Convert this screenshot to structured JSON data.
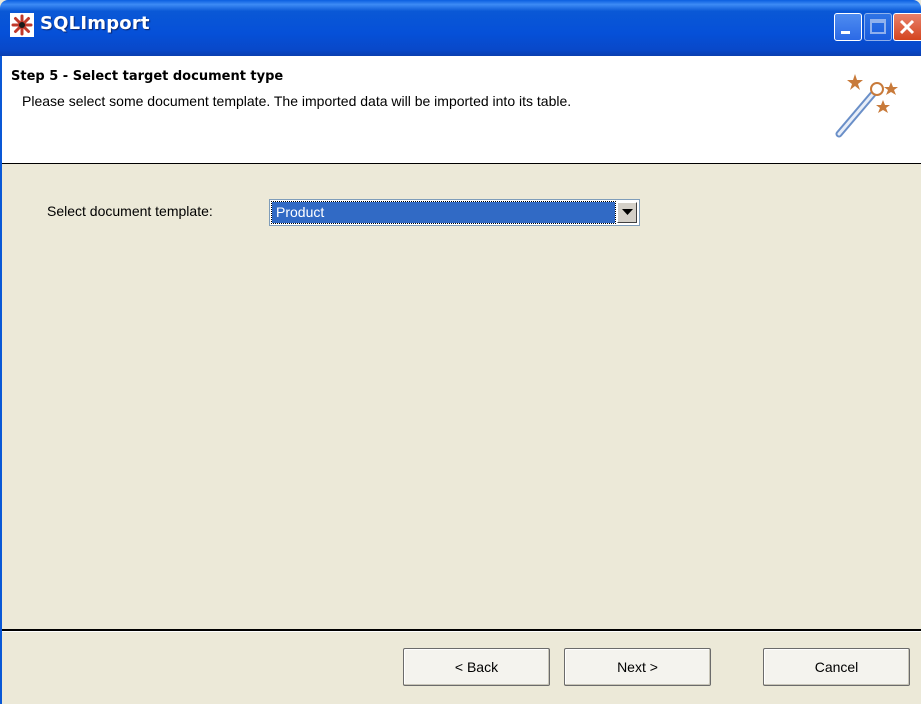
{
  "window": {
    "title": "SQLImport"
  },
  "header": {
    "step_title": "Step 5 - Select target document type",
    "step_description": "Please select some document template. The imported data will be imported into its table."
  },
  "form": {
    "template_label": "Select document template:",
    "template_value": "Product"
  },
  "buttons": {
    "back": "< Back",
    "next": "Next >",
    "cancel": "Cancel"
  },
  "icons": {
    "app": "app-asterisk-icon",
    "wizard": "magic-wand-icon",
    "dropdown": "chevron-down-icon"
  },
  "colors": {
    "titlebar": "#0a58d6",
    "selection": "#316ac5",
    "dialog_bg": "#ece9d8"
  }
}
